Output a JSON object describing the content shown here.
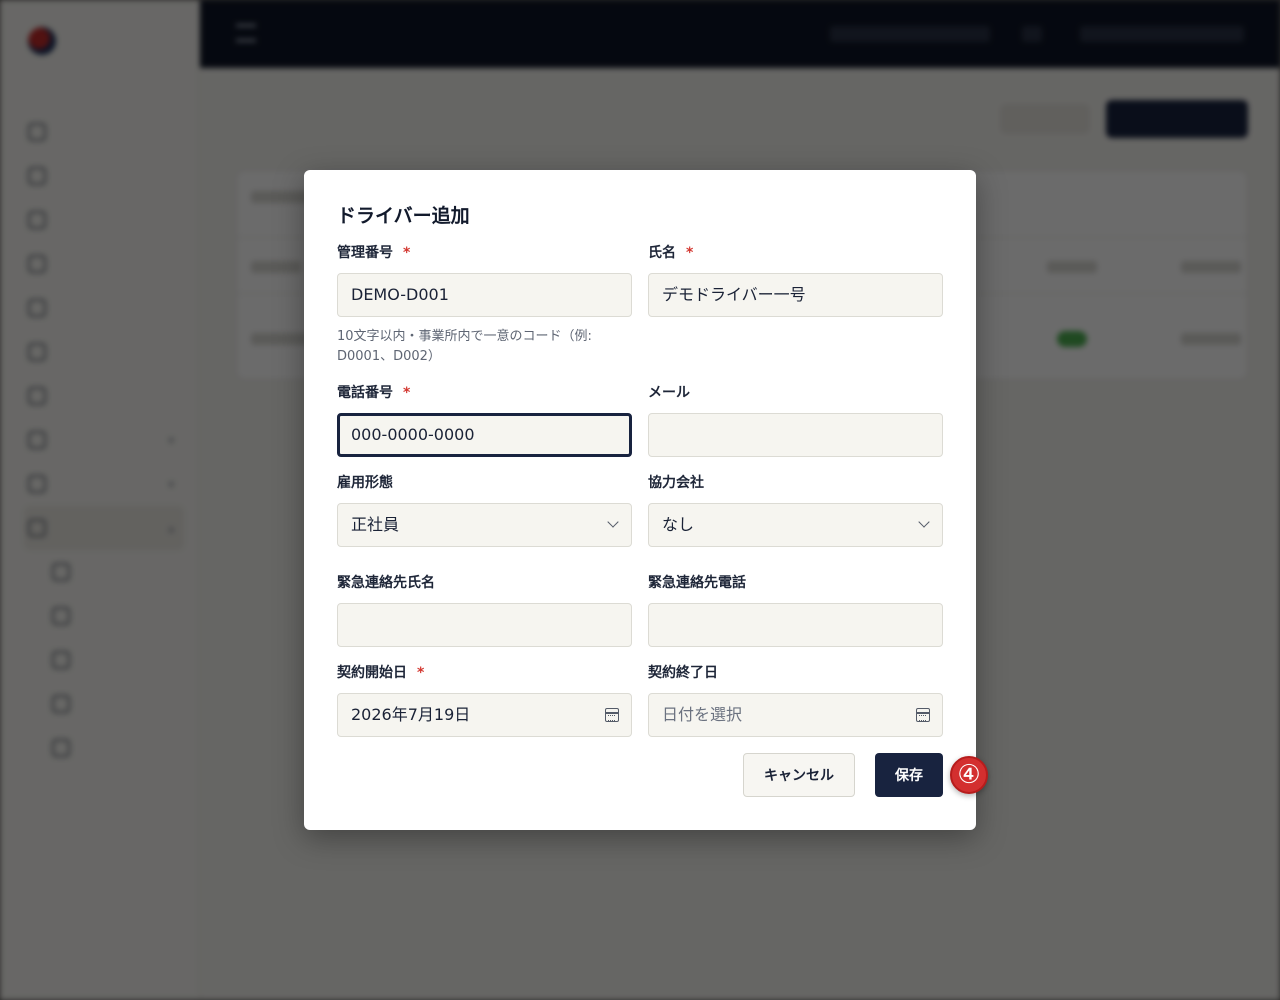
{
  "modal": {
    "title": "ドライバー追加",
    "required_mark": "*",
    "fields": {
      "management_number": {
        "label": "管理番号",
        "required": true,
        "value": "DEMO-D001",
        "help": "10文字以内・事業所内で一意のコード（例: D0001、D002）"
      },
      "name": {
        "label": "氏名",
        "required": true,
        "value": "デモドライバー一号"
      },
      "phone": {
        "label": "電話番号",
        "required": true,
        "value": "000-0000-0000",
        "focused": true
      },
      "email": {
        "label": "メール",
        "required": false,
        "value": ""
      },
      "employment_type": {
        "label": "雇用形態",
        "selected": "正社員"
      },
      "partner_company": {
        "label": "協力会社",
        "selected": "なし"
      },
      "emergency_contact_name": {
        "label": "緊急連絡先氏名",
        "value": ""
      },
      "emergency_contact_phone": {
        "label": "緊急連絡先電話",
        "value": ""
      },
      "contract_start": {
        "label": "契約開始日",
        "required": true,
        "value": "2026年7月19日",
        "icon": "calendar-icon"
      },
      "contract_end": {
        "label": "契約終了日",
        "placeholder": "日付を選択",
        "icon": "calendar-icon"
      }
    },
    "buttons": {
      "cancel": "キャンセル",
      "save": "保存"
    }
  },
  "annotation": {
    "step_marker": "④"
  },
  "colors": {
    "primary": "#18233f",
    "required": "#d3362f",
    "input_bg": "#f6f5f0",
    "marker": "#d32f2f"
  }
}
